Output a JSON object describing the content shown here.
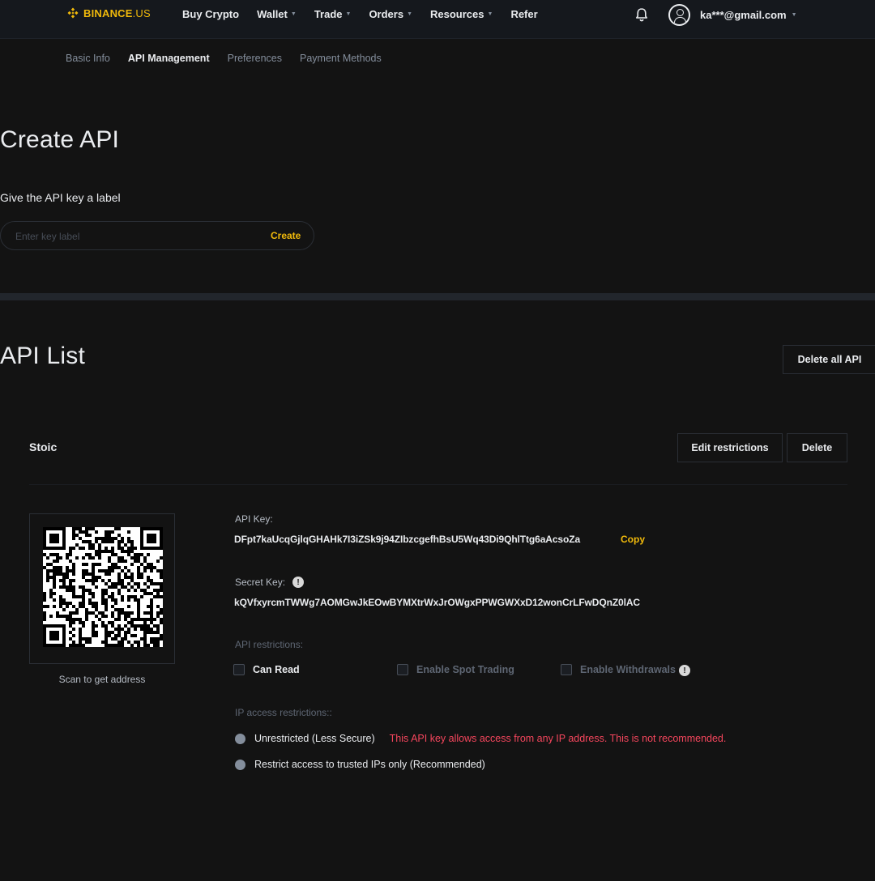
{
  "brand": {
    "name": "BINANCE",
    "suffix": ".US",
    "color": "#f0b90b"
  },
  "nav": {
    "items": [
      {
        "label": "Buy Crypto",
        "caret": false
      },
      {
        "label": "Wallet",
        "caret": true
      },
      {
        "label": "Trade",
        "caret": true
      },
      {
        "label": "Orders",
        "caret": true
      },
      {
        "label": "Resources",
        "caret": true
      },
      {
        "label": "Refer",
        "caret": false
      }
    ],
    "notifications_icon": "bell-icon",
    "account_icon": "user-circle-icon",
    "account_email": "ka***@gmail.com"
  },
  "subtabs": [
    {
      "label": "Basic Info",
      "active": false
    },
    {
      "label": "API Management",
      "active": true
    },
    {
      "label": "Preferences",
      "active": false
    },
    {
      "label": "Payment Methods",
      "active": false
    }
  ],
  "create": {
    "title": "Create API",
    "prompt": "Give the API key a label",
    "input_placeholder": "Enter key label",
    "input_value": "",
    "button_label": "Create"
  },
  "list": {
    "title": "API List",
    "delete_all_label": "Delete all API",
    "api": {
      "name": "Stoic",
      "edit_label": "Edit restrictions",
      "delete_label": "Delete",
      "qr_caption": "Scan to get address",
      "api_key_label": "API Key:",
      "api_key": "DFpt7kaUcqGjlqGHAHk7I3iZSk9j94ZIbzcgefhBsU5Wq43Di9QhlTtg6aAcsoZa",
      "copy_label": "Copy",
      "secret_key_label": "Secret Key:",
      "secret_key": "kQVfxyrcmTWWg7AOMGwJkEOwBYMXtrWxJrOWgxPPWGWXxD12wonCrLFwDQnZ0lAC",
      "restrictions_label": "API restrictions:",
      "restrictions": [
        {
          "label": "Can Read",
          "enabled": true,
          "checked": false,
          "info": false
        },
        {
          "label": "Enable Spot Trading",
          "enabled": false,
          "checked": false,
          "info": false
        },
        {
          "label": "Enable Withdrawals",
          "enabled": false,
          "checked": false,
          "info": true
        }
      ],
      "ip_label": "IP access restrictions::",
      "ip_options": [
        {
          "label": "Unrestricted (Less Secure)",
          "warning": "This API key allows access from any IP address. This is not recommended."
        },
        {
          "label": "Restrict access to trusted IPs only (Recommended)",
          "warning": ""
        }
      ]
    }
  },
  "colors": {
    "accent": "#f0b90b",
    "danger": "#f6465d",
    "background": "#131313"
  }
}
